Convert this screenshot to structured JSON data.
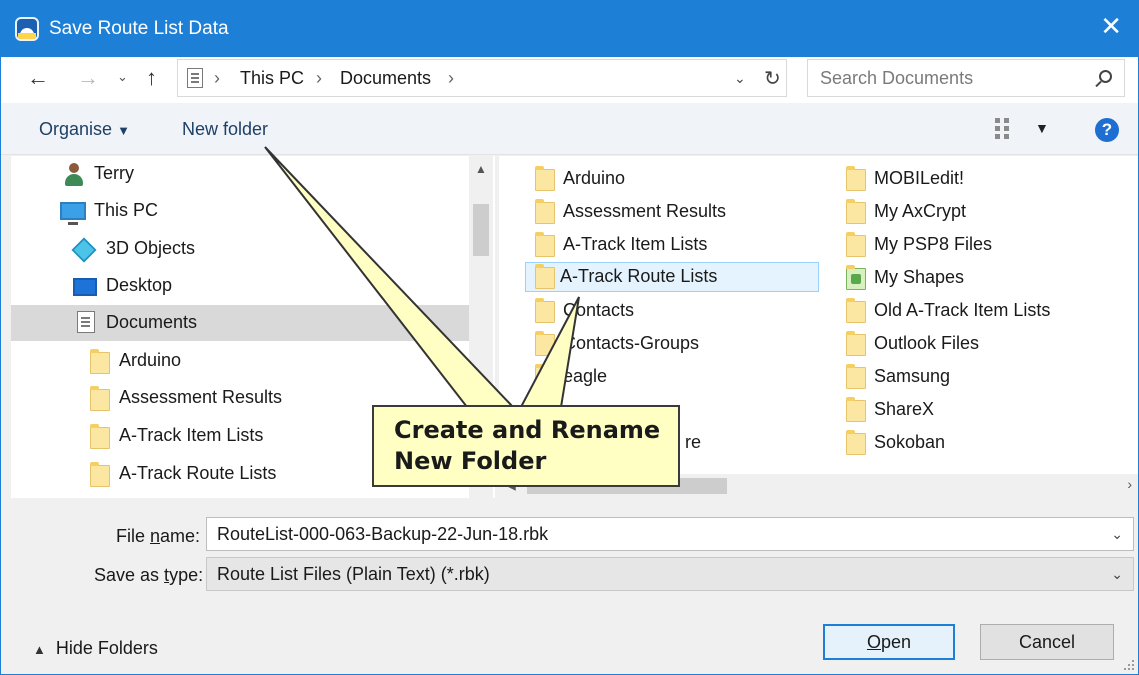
{
  "window": {
    "title": "Save Route List Data",
    "close_glyph": "✕"
  },
  "address": {
    "crumbs": [
      "This PC",
      "Documents"
    ],
    "search_placeholder": "Search Documents"
  },
  "toolbar": {
    "organise_label": "Organise",
    "new_folder_label": "New folder",
    "help_glyph": "?"
  },
  "nav_pane": {
    "items": [
      {
        "label": "Terry",
        "icon": "user-icon"
      },
      {
        "label": "This PC",
        "icon": "pc-icon"
      },
      {
        "label": "3D Objects",
        "icon": "3d-objects-icon"
      },
      {
        "label": "Desktop",
        "icon": "desktop-icon"
      },
      {
        "label": "Documents",
        "icon": "documents-icon",
        "selected": true
      },
      {
        "label": "Arduino",
        "icon": "folder-icon"
      },
      {
        "label": "Assessment Results",
        "icon": "folder-icon"
      },
      {
        "label": "A-Track Item Lists",
        "icon": "folder-icon"
      },
      {
        "label": "A-Track Route Lists",
        "icon": "folder-icon"
      }
    ]
  },
  "files": {
    "column1": [
      "Arduino",
      "Assessment Results",
      "A-Track Item Lists",
      "A-Track Route Lists",
      "Contacts",
      "Contacts-Groups",
      "eagle"
    ],
    "column2": [
      "MOBILedit!",
      "My AxCrypt",
      "My PSP8 Files",
      "My Shapes",
      "Old A-Track Item Lists",
      "Outlook Files",
      "Samsung",
      "ShareX",
      "Sokoban"
    ],
    "selected": "A-Track Route Lists",
    "partially_hidden_suffix": "re"
  },
  "form": {
    "file_name_label_pre": "File ",
    "file_name_label_key": "n",
    "file_name_label_post": "ame:",
    "file_name_value": "RouteList-000-063-Backup-22-Jun-18.rbk",
    "save_type_label_pre": "Save as ",
    "save_type_label_key": "t",
    "save_type_label_post": "ype:",
    "save_type_value": "Route List Files (Plain Text) (*.rbk)"
  },
  "footer": {
    "hide_folders_label": "Hide Folders",
    "open_key": "O",
    "open_rest": "pen",
    "cancel_label": "Cancel"
  },
  "callout": {
    "line1": "Create and Rename",
    "line2": "New Folder",
    "fill_color": "#ffffc4"
  },
  "colors": {
    "title_bar": "#1e7fd6",
    "selection": "#e5f3ff"
  }
}
